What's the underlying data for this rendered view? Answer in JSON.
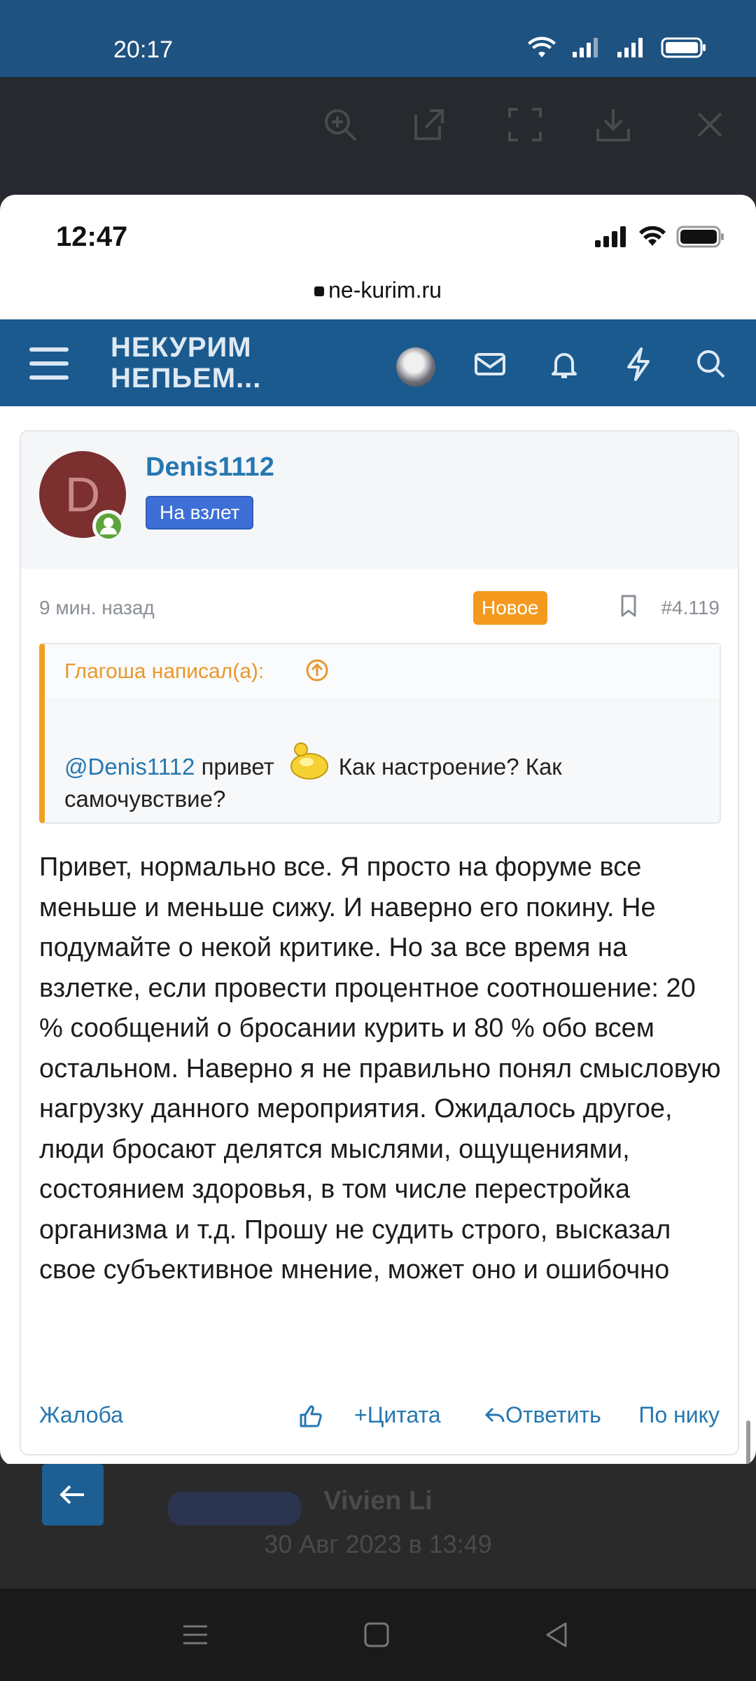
{
  "outer_status": {
    "time": "20:17"
  },
  "viewer_bottom": {
    "name": "Vivien Li",
    "date": "30 Авг 2023 в 13:49"
  },
  "ios_status": {
    "time": "12:47"
  },
  "browser": {
    "url": "ne-kurim.ru"
  },
  "site": {
    "logo_line1": "НЕКУРИМ",
    "logo_line2": "НЕПЬЕМ..."
  },
  "post": {
    "author": "Denis1112",
    "avatar_letter": "D",
    "rank": "На взлет",
    "time": "9 мин. назад",
    "new_badge": "Новое",
    "number": "#4.119",
    "quote": {
      "author": "Глагоша написал(а):",
      "mention": "@Denis1112",
      "text_before": "привет",
      "text_after": "Как настроение? Как самочувствие?"
    },
    "body": "Привет, нормально все. Я просто на форуме все меньше и меньше сижу. И наверно его покину. Не подумайте о некой критике. Но за все время на взлетке, если провести процентное соотношение: 20 % сообщений о бросании курить и 80 % обо всем остальном. Наверно я не правильно понял смысловую нагрузку данного мероприятия. Ожидалось другое, люди бросают делятся мыслями, ощущениями, состоянием здоровья, в том числе перестройка организма и т.д. Прошу не судить строго, высказал свое субъективное мнение, может оно и ошибочно",
    "actions": {
      "report": "Жалоба",
      "quote": "Цитата",
      "reply": "Ответить",
      "by_nick": "По нику"
    }
  },
  "colors": {
    "header": "#1a5a8f",
    "link": "#2577b1",
    "new_badge": "#f39a1e",
    "quote_border": "#f0a020"
  }
}
